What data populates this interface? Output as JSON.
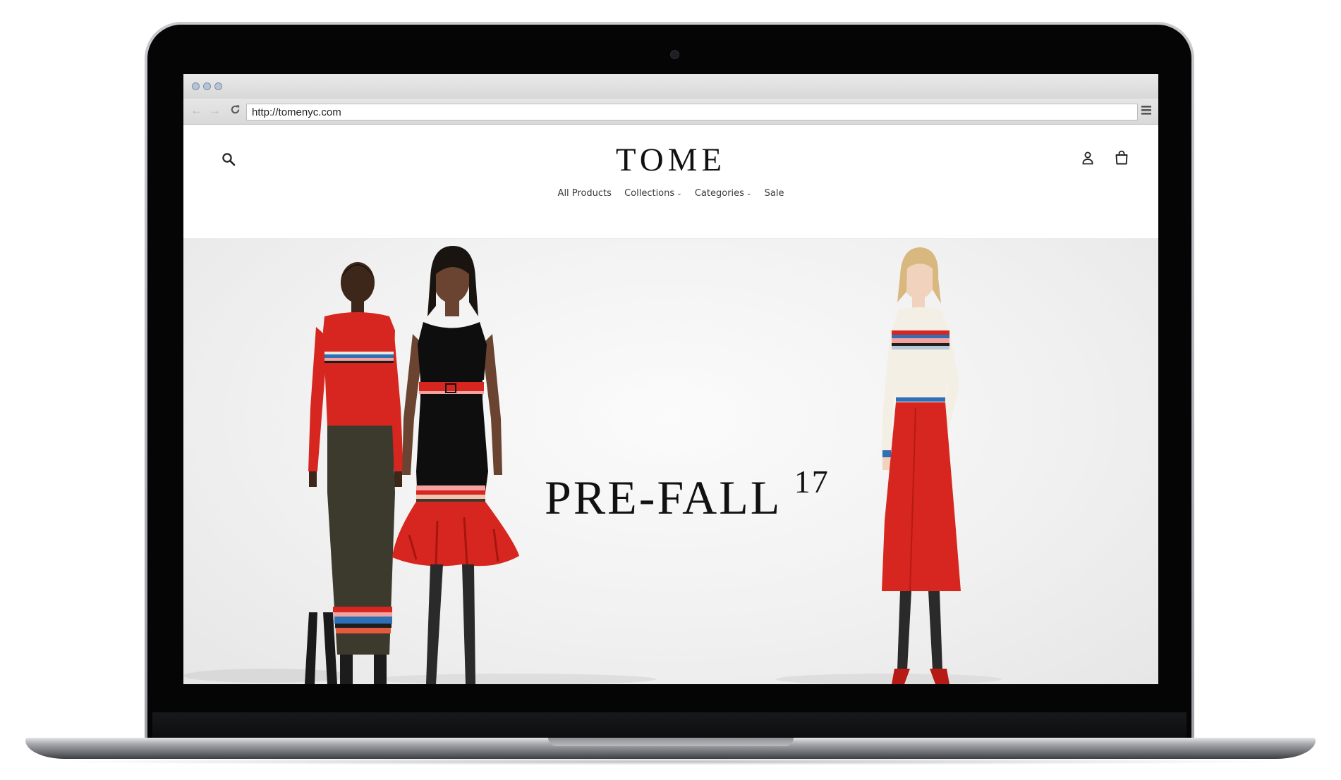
{
  "browser": {
    "url": "http://tomenyc.com"
  },
  "site": {
    "logo": "TOME",
    "nav": [
      {
        "label": "All Products",
        "has_dropdown": false
      },
      {
        "label": "Collections",
        "has_dropdown": true
      },
      {
        "label": "Categories",
        "has_dropdown": true
      },
      {
        "label": "Sale",
        "has_dropdown": false
      }
    ],
    "icons": [
      "search-icon",
      "account-icon",
      "cart-icon"
    ]
  },
  "hero": {
    "headline_main": "PRE-FALL",
    "headline_year": "17"
  },
  "colors": {
    "dress_red": "#d7261f",
    "knit_green": "#3c3a2c",
    "stripe_blue": "#2f6fb5",
    "stripe_pink": "#f2a3a0",
    "ink": "#111111"
  }
}
